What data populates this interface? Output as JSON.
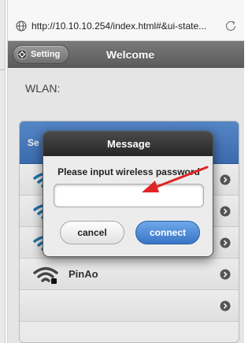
{
  "browser": {
    "url": "http://10.10.10.254/index.html#&ui-state...",
    "icons": {
      "site": "globe-icon",
      "reload": "reload-icon"
    }
  },
  "header": {
    "setting_label": "Setting",
    "title": "Welcome",
    "setting_icon": "gear-icon"
  },
  "wlan_label": "WLAN:",
  "network_list": {
    "header_text": "Se",
    "items": [
      {
        "name": ""
      },
      {
        "name": ""
      },
      {
        "name": ""
      },
      {
        "name": "PinAo"
      },
      {
        "name": ""
      }
    ]
  },
  "dialog": {
    "title": "Message",
    "prompt": "Please input wireless password",
    "password_value": "",
    "cancel_label": "cancel",
    "connect_label": "connect"
  },
  "colors": {
    "accent": "#3f72b8",
    "header_gray": "#6a6a6a",
    "arrow_red": "#e02424"
  }
}
